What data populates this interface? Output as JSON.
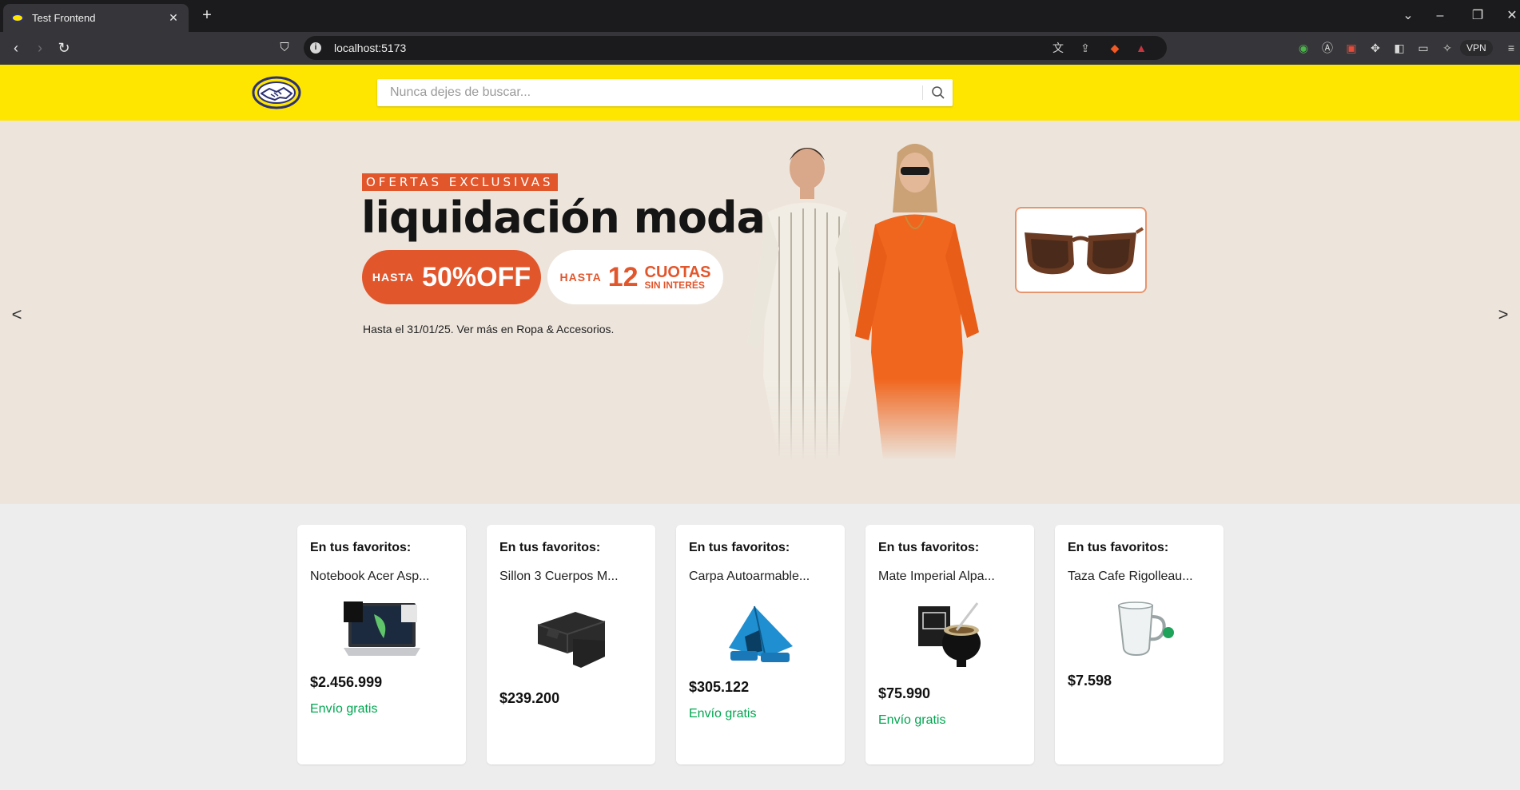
{
  "browser": {
    "tab_title": "Test Frontend",
    "url": "localhost:5173",
    "vpn_label": "VPN"
  },
  "header": {
    "search_placeholder": "Nunca dejes de buscar..."
  },
  "banner": {
    "tag": "OFERTAS EXCLUSIVAS",
    "title": "liquidación moda",
    "offer_prefix": "HASTA",
    "offer_value": "50%OFF",
    "cuotas_prefix": "HASTA",
    "cuotas_number": "12",
    "cuotas_label": "CUOTAS",
    "cuotas_sub": "SIN INTERÉS",
    "footer": "Hasta el 31/01/25. Ver más en Ropa & Accesorios.",
    "prev_label": "<",
    "next_label": ">"
  },
  "cards": [
    {
      "heading": "En tus favoritos:",
      "name": "Notebook Acer Asp...",
      "price": "$2.456.999",
      "shipping": "Envío gratis",
      "icon": "laptop-icon"
    },
    {
      "heading": "En tus favoritos:",
      "name": "Sillon 3 Cuerpos M...",
      "price": "$239.200",
      "shipping": "",
      "icon": "sofa-icon"
    },
    {
      "heading": "En tus favoritos:",
      "name": "Carpa Autoarmable...",
      "price": "$305.122",
      "shipping": "Envío gratis",
      "icon": "tent-icon"
    },
    {
      "heading": "En tus favoritos:",
      "name": "Mate Imperial Alpa...",
      "price": "$75.990",
      "shipping": "Envío gratis",
      "icon": "mate-icon"
    },
    {
      "heading": "En tus favoritos:",
      "name": "Taza Cafe Rigolleau...",
      "price": "$7.598",
      "shipping": "",
      "icon": "mug-icon"
    }
  ],
  "colors": {
    "header_bg": "#ffe600",
    "banner_bg": "#ede5dc",
    "accent_orange": "#e2562c",
    "shipping_green": "#00a650"
  }
}
